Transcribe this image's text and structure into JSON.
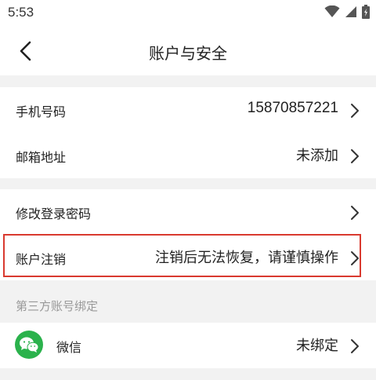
{
  "status_bar": {
    "time": "5:53",
    "icons": [
      "wifi-icon",
      "signal-icon",
      "battery-icon"
    ]
  },
  "nav": {
    "title": "账户与安全",
    "back_icon": "back-arrow-icon"
  },
  "rows": {
    "phone": {
      "label": "手机号码",
      "value": "15870857221"
    },
    "email": {
      "label": "邮箱地址",
      "value": "未添加"
    },
    "change_password": {
      "label": "修改登录密码",
      "value": ""
    },
    "delete_account": {
      "label": "账户注销",
      "value": "注销后无法恢复，请谨慎操作"
    }
  },
  "third_party": {
    "header": "第三方账号绑定",
    "wechat": {
      "label": "微信",
      "value": "未绑定",
      "icon": "wechat-icon"
    }
  },
  "colors": {
    "highlight_border": "#d93a2f",
    "wechat_green": "#2bb24c",
    "page_background": "#f2f2f2"
  }
}
